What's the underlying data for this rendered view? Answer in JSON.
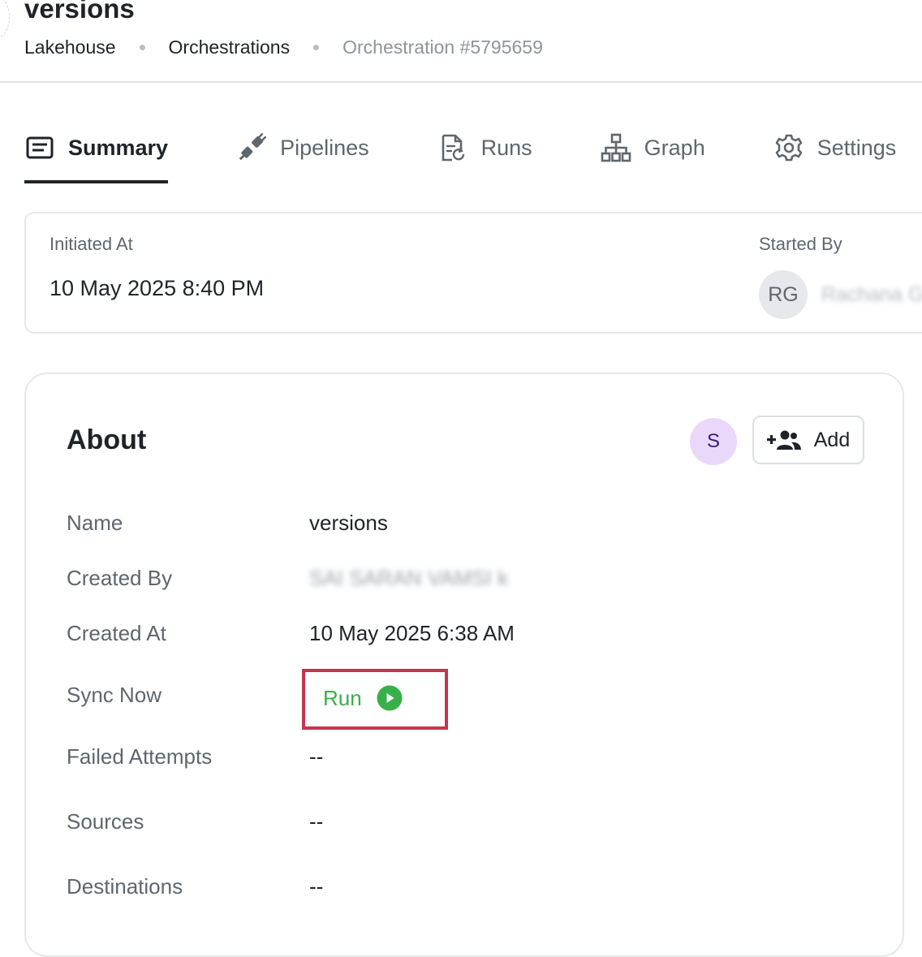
{
  "header": {
    "title": "versions",
    "breadcrumb": [
      "Lakehouse",
      "Orchestrations",
      "Orchestration #5795659"
    ]
  },
  "tabs": [
    {
      "label": "Summary",
      "icon": "list-card-icon",
      "active": true
    },
    {
      "label": "Pipelines",
      "icon": "plug-icon",
      "active": false
    },
    {
      "label": "Runs",
      "icon": "document-refresh-icon",
      "active": false
    },
    {
      "label": "Graph",
      "icon": "hierarchy-icon",
      "active": false
    },
    {
      "label": "Settings",
      "icon": "gear-icon",
      "active": false
    }
  ],
  "info": {
    "initiated_label": "Initiated At",
    "initiated_value": "10 May 2025 8:40 PM",
    "started_by_label": "Started By",
    "started_by_initials": "RG",
    "started_by_name": "Rachana G"
  },
  "about": {
    "title": "About",
    "avatar_initial": "S",
    "add_label": "Add",
    "rows": {
      "name": {
        "label": "Name",
        "value": "versions"
      },
      "created_by": {
        "label": "Created By",
        "value": "SAI SARAN VAMSI k"
      },
      "created_at": {
        "label": "Created At",
        "value": "10 May 2025 6:38 AM"
      },
      "sync_now": {
        "label": "Sync Now",
        "value": "Run"
      },
      "failed_attempts": {
        "label": "Failed Attempts",
        "value": "--"
      },
      "sources": {
        "label": "Sources",
        "value": "--"
      },
      "destinations": {
        "label": "Destinations",
        "value": "--"
      }
    }
  },
  "colors": {
    "accent_text": "#1f2328",
    "muted_text": "#5f666d",
    "run_green": "#38b04a",
    "highlight_red": "#c7344f",
    "avatar_purple_bg": "#ead8fb"
  }
}
